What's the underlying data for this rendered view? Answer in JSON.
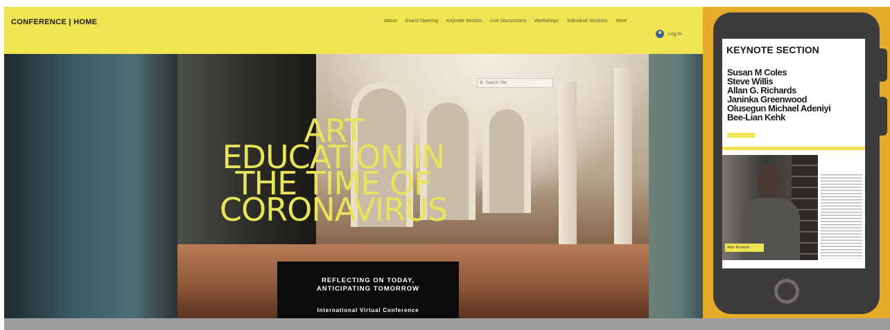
{
  "site": {
    "brand": "CONFERENCE | HOME",
    "nav": [
      "About",
      "Grand Opening",
      "Keynote Section",
      "Live Discussions",
      "Workshops",
      "Individual Sections",
      "More"
    ],
    "login_label": "Log In",
    "search_placeholder": "Search Site",
    "headline": [
      "ART",
      "EDUCATION IN",
      "THE TIME OF",
      "CORONAVIRUS"
    ],
    "tagline": [
      "REFLECTING ON TODAY,",
      "ANTICIPATING TOMORROW"
    ],
    "subtagline": "International Virtual Conference",
    "colors": {
      "accent": "#efe552",
      "dark": "#0b0b0b"
    }
  },
  "phone": {
    "section_title": "KEYNOTE SECTION",
    "speakers": [
      "Susan M Coles",
      "Steve Willis",
      "Allan G. Richards",
      "Janinka Greenwood",
      "Olusegun Michael Adeniyi",
      "Bee-Lian Kehk"
    ],
    "photo_caption": "Allan Richards",
    "frame_color": "#e7ab2a"
  }
}
